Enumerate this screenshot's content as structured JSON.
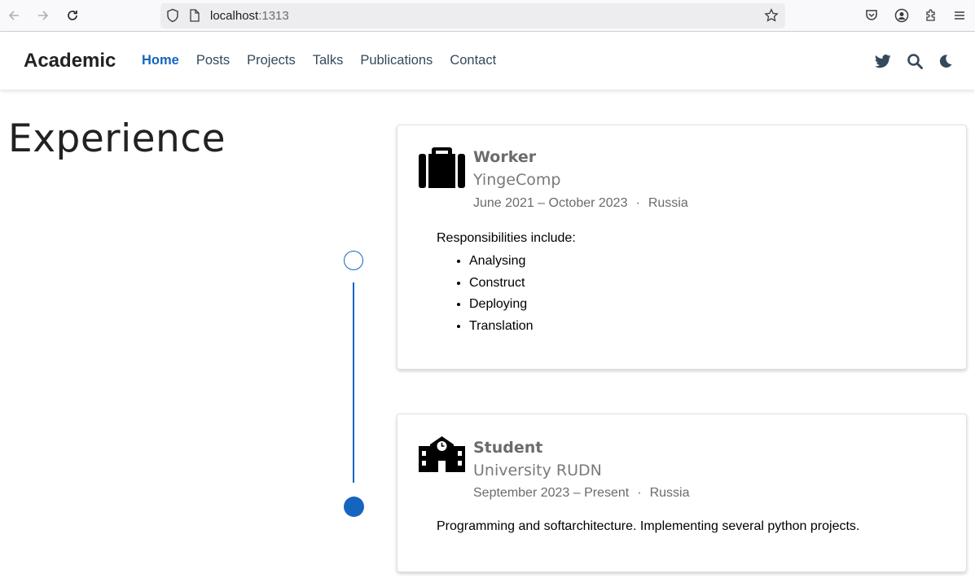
{
  "browser": {
    "url_host": "localhost",
    "url_port": ":1313"
  },
  "site": {
    "brand": "Academic",
    "menu": [
      {
        "label": "Home",
        "active": true
      },
      {
        "label": "Posts",
        "active": false
      },
      {
        "label": "Projects",
        "active": false
      },
      {
        "label": "Talks",
        "active": false
      },
      {
        "label": "Publications",
        "active": false
      },
      {
        "label": "Contact",
        "active": false
      }
    ],
    "right_icons": [
      "twitter-icon",
      "search-icon",
      "moon-icon"
    ]
  },
  "experience": {
    "title": "Experience",
    "items": [
      {
        "role": "Worker",
        "org": "YingeComp",
        "dates": "June 2021 – October 2023",
        "location": "Russia",
        "icon": "briefcase-icon",
        "intro": "Responsibilities include:",
        "bullets": [
          "Analysing",
          "Construct",
          "Deploying",
          "Translation"
        ]
      },
      {
        "role": "Student",
        "org": "University RUDN",
        "dates": "September 2023 – Present",
        "location": "Russia",
        "icon": "school-icon",
        "description": "Programming and softarchitecture. Implementing several python projects."
      }
    ]
  },
  "colors": {
    "accent": "#1565c0",
    "nav_text": "#34495e",
    "muted": "#6b6b6b"
  }
}
